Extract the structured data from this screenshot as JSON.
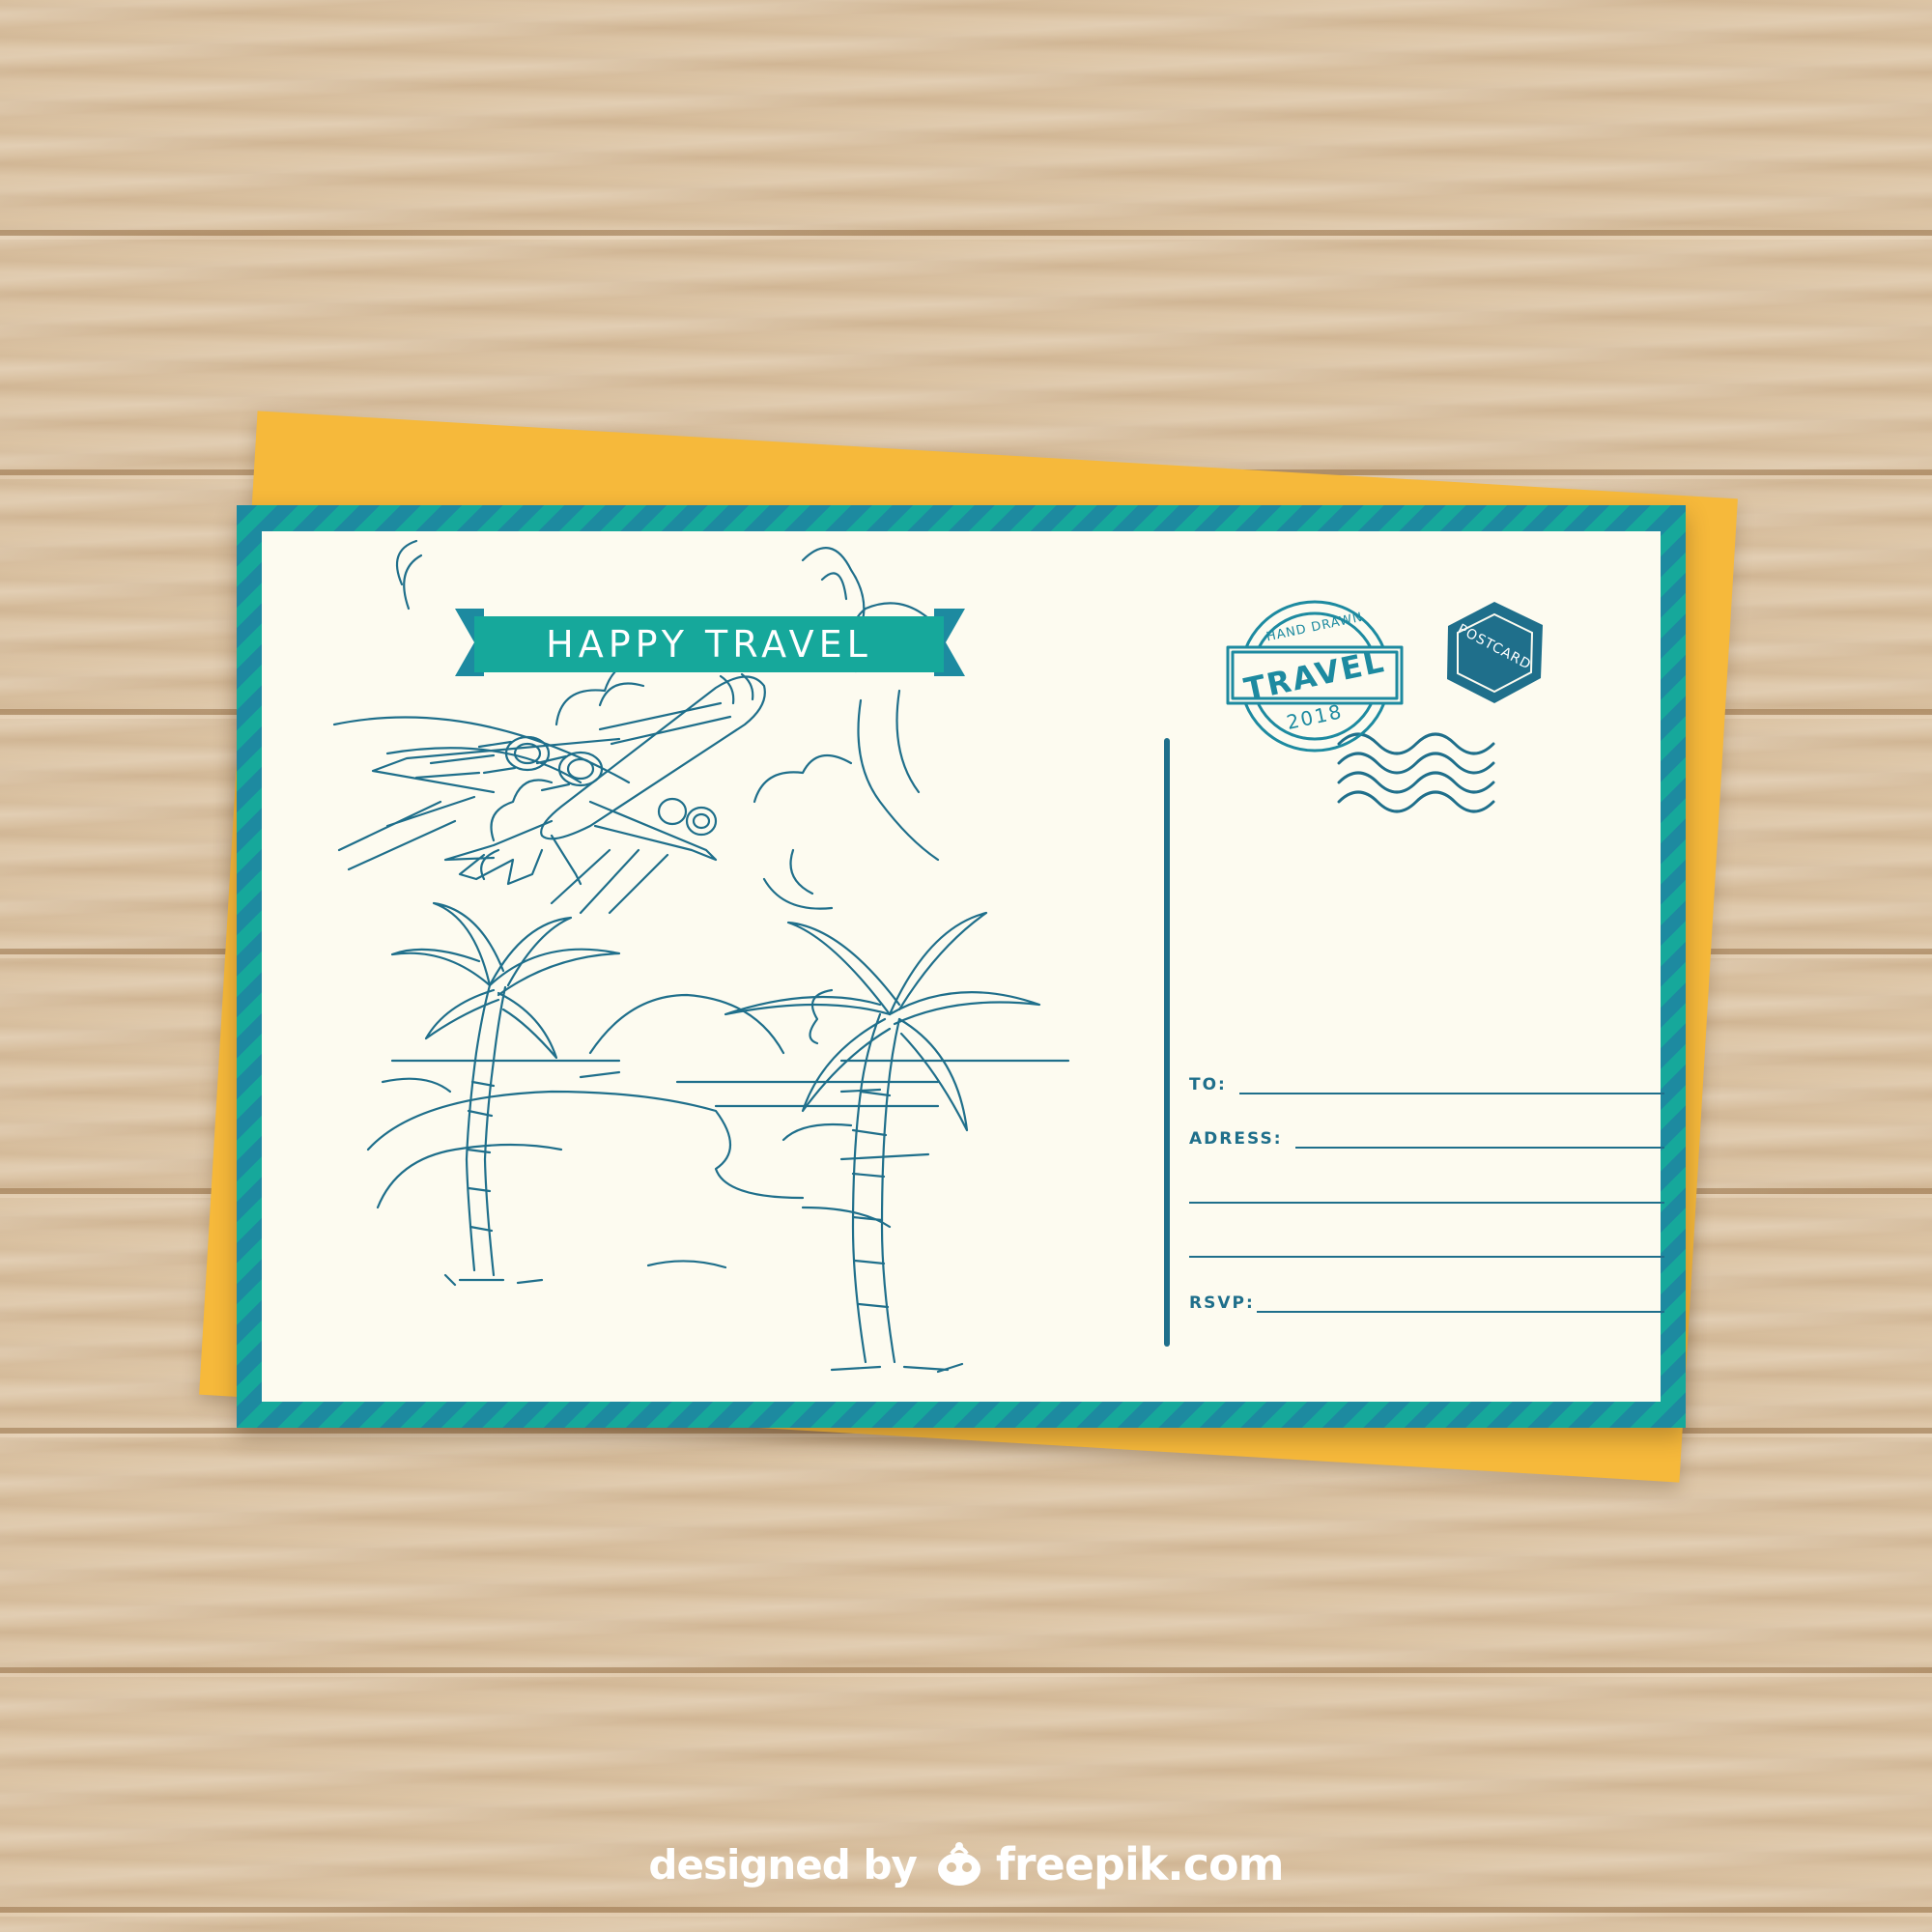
{
  "banner": {
    "text": "HAPPY TRAVEL"
  },
  "round_stamp": {
    "top_text": "HAND DRAWN",
    "main_text": "TRAVEL",
    "year": "2018"
  },
  "hex_stamp": {
    "text": "POSTCARD"
  },
  "address": {
    "to_label": "TO:",
    "address_label": "ADRESS:",
    "rsvp_label": "RSVP:"
  },
  "footer": {
    "designed_by": "designed by",
    "brand": "freepik.com"
  },
  "colors": {
    "ink": "#1f6f8b",
    "teal": "#16a89b",
    "paper": "#fdfbf0",
    "back_paper": "#f6b93b",
    "wood": "#dcc4a4"
  },
  "icons": [
    "airplane-icon",
    "palm-tree-icon",
    "sun-icon",
    "cloud-icon",
    "wavy-postmark-icon",
    "freepik-logo-icon"
  ]
}
